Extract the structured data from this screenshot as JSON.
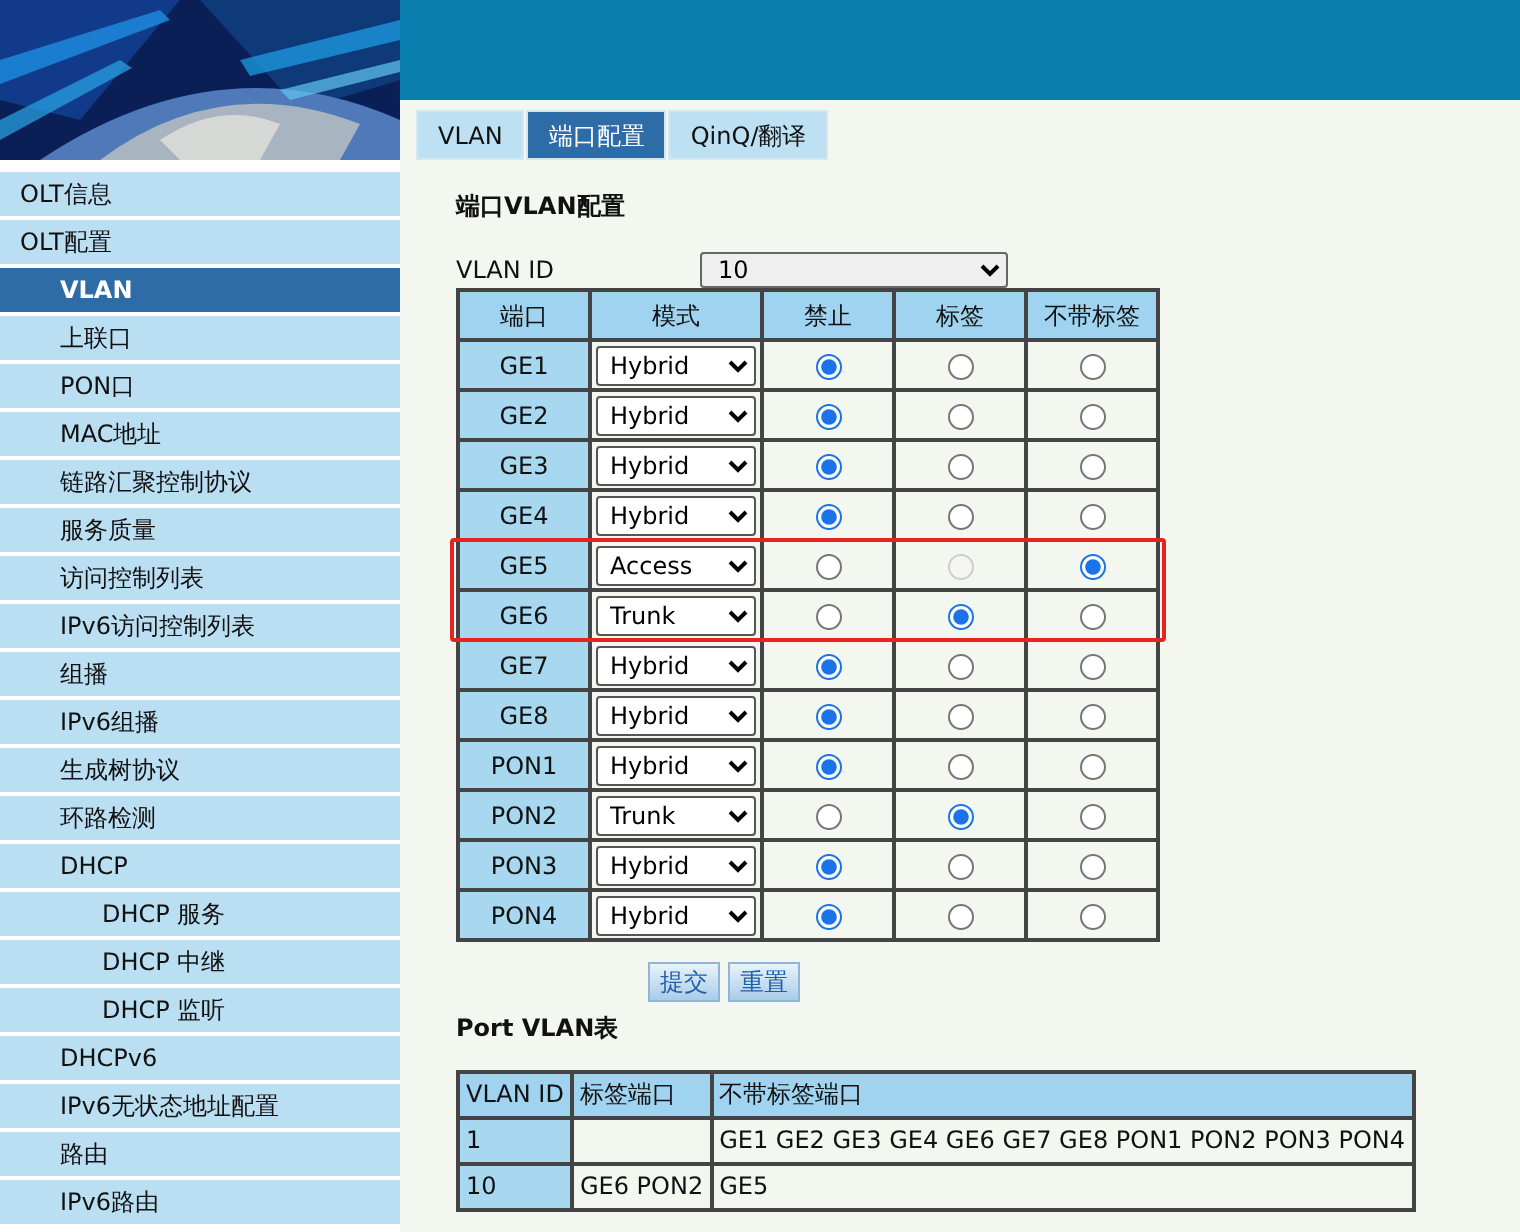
{
  "tabs": [
    {
      "label": "VLAN",
      "selected": false
    },
    {
      "label": "端口配置",
      "selected": true
    },
    {
      "label": "QinQ/翻译",
      "selected": false
    }
  ],
  "sidebar": {
    "items": [
      {
        "label": "OLT信息",
        "selected": false
      },
      {
        "label": "OLT配置",
        "selected": false,
        "children": [
          {
            "label": "VLAN",
            "selected": true
          },
          {
            "label": "上联口",
            "selected": false
          },
          {
            "label": "PON口",
            "selected": false
          },
          {
            "label": "MAC地址",
            "selected": false
          },
          {
            "label": "链路汇聚控制协议",
            "selected": false
          },
          {
            "label": "服务质量",
            "selected": false
          },
          {
            "label": "访问控制列表",
            "selected": false
          },
          {
            "label": "IPv6访问控制列表",
            "selected": false
          },
          {
            "label": "组播",
            "selected": false
          },
          {
            "label": "IPv6组播",
            "selected": false
          },
          {
            "label": "生成树协议",
            "selected": false
          },
          {
            "label": "环路检测",
            "selected": false
          },
          {
            "label": "DHCP",
            "selected": false,
            "children": [
              {
                "label": "DHCP 服务",
                "selected": false
              },
              {
                "label": "DHCP 中继",
                "selected": false
              },
              {
                "label": "DHCP 监听",
                "selected": false
              }
            ]
          },
          {
            "label": "DHCPv6",
            "selected": false
          },
          {
            "label": "IPv6无状态地址配置",
            "selected": false
          },
          {
            "label": "路由",
            "selected": false
          },
          {
            "label": "IPv6路由",
            "selected": false
          }
        ]
      }
    ]
  },
  "port_vlan_config": {
    "title": "端口VLAN配置",
    "vlan_id_label": "VLAN ID",
    "vlan_id": "10",
    "columns": [
      "端口",
      "模式",
      "禁止",
      "标签",
      "不带标签"
    ],
    "rows": [
      {
        "port": "GE1",
        "mode": "Hybrid",
        "highlighted": false,
        "options": [
          {
            "selected": true,
            "disabled": false
          },
          {
            "selected": false,
            "disabled": false
          },
          {
            "selected": false,
            "disabled": false
          }
        ]
      },
      {
        "port": "GE2",
        "mode": "Hybrid",
        "highlighted": false,
        "options": [
          {
            "selected": true,
            "disabled": false
          },
          {
            "selected": false,
            "disabled": false
          },
          {
            "selected": false,
            "disabled": false
          }
        ]
      },
      {
        "port": "GE3",
        "mode": "Hybrid",
        "highlighted": false,
        "options": [
          {
            "selected": true,
            "disabled": false
          },
          {
            "selected": false,
            "disabled": false
          },
          {
            "selected": false,
            "disabled": false
          }
        ]
      },
      {
        "port": "GE4",
        "mode": "Hybrid",
        "highlighted": false,
        "options": [
          {
            "selected": true,
            "disabled": false
          },
          {
            "selected": false,
            "disabled": false
          },
          {
            "selected": false,
            "disabled": false
          }
        ]
      },
      {
        "port": "GE5",
        "mode": "Access",
        "highlighted": true,
        "options": [
          {
            "selected": false,
            "disabled": false
          },
          {
            "selected": false,
            "disabled": true
          },
          {
            "selected": true,
            "disabled": false
          }
        ]
      },
      {
        "port": "GE6",
        "mode": "Trunk",
        "highlighted": true,
        "options": [
          {
            "selected": false,
            "disabled": false
          },
          {
            "selected": true,
            "disabled": false
          },
          {
            "selected": false,
            "disabled": false
          }
        ]
      },
      {
        "port": "GE7",
        "mode": "Hybrid",
        "highlighted": false,
        "options": [
          {
            "selected": true,
            "disabled": false
          },
          {
            "selected": false,
            "disabled": false
          },
          {
            "selected": false,
            "disabled": false
          }
        ]
      },
      {
        "port": "GE8",
        "mode": "Hybrid",
        "highlighted": false,
        "options": [
          {
            "selected": true,
            "disabled": false
          },
          {
            "selected": false,
            "disabled": false
          },
          {
            "selected": false,
            "disabled": false
          }
        ]
      },
      {
        "port": "PON1",
        "mode": "Hybrid",
        "highlighted": false,
        "options": [
          {
            "selected": true,
            "disabled": false
          },
          {
            "selected": false,
            "disabled": false
          },
          {
            "selected": false,
            "disabled": false
          }
        ]
      },
      {
        "port": "PON2",
        "mode": "Trunk",
        "highlighted": false,
        "options": [
          {
            "selected": false,
            "disabled": false
          },
          {
            "selected": true,
            "disabled": false
          },
          {
            "selected": false,
            "disabled": false
          }
        ]
      },
      {
        "port": "PON3",
        "mode": "Hybrid",
        "highlighted": false,
        "options": [
          {
            "selected": true,
            "disabled": false
          },
          {
            "selected": false,
            "disabled": false
          },
          {
            "selected": false,
            "disabled": false
          }
        ]
      },
      {
        "port": "PON4",
        "mode": "Hybrid",
        "highlighted": false,
        "options": [
          {
            "selected": true,
            "disabled": false
          },
          {
            "selected": false,
            "disabled": false
          },
          {
            "selected": false,
            "disabled": false
          }
        ]
      }
    ],
    "buttons": [
      "提交",
      "重置"
    ]
  },
  "port_vlan_table": {
    "title": "Port VLAN表",
    "columns": [
      "VLAN ID",
      "标签端口",
      "不带标签端口"
    ],
    "rows": [
      [
        "1",
        "",
        "GE1 GE2 GE3 GE4 GE6 GE7 GE8 PON1 PON2 PON3 PON4"
      ],
      [
        "10",
        "GE6 PON2",
        "GE5"
      ]
    ]
  }
}
